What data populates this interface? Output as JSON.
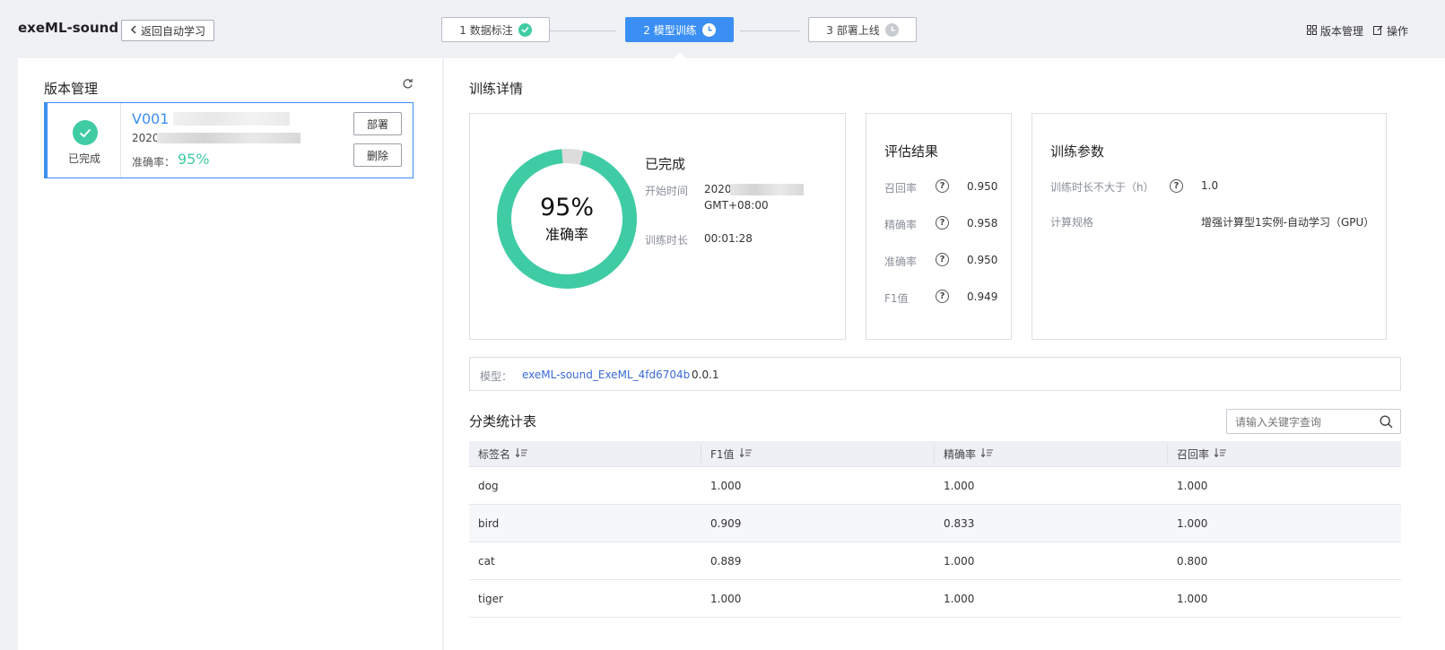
{
  "header": {
    "app_title": "exeML-sound",
    "back_label": "返回自动学习",
    "steps": [
      {
        "label": "1 数据标注",
        "state": "done"
      },
      {
        "label": "2 模型训练",
        "state": "active"
      },
      {
        "label": "3 部署上线",
        "state": "pending"
      }
    ],
    "version_mgmt_label": "版本管理",
    "ops_label": "操作"
  },
  "left": {
    "title": "版本管理",
    "version": {
      "name": "V001",
      "date_prefix": "2020",
      "status": "已完成",
      "accuracy_label": "准确率：",
      "accuracy_value": "95%",
      "deploy_label": "部署",
      "delete_label": "删除"
    }
  },
  "detail": {
    "title": "训练详情",
    "progress": {
      "percent_text": "95%",
      "percent": 0.95,
      "caption": "准确率",
      "status": "已完成",
      "start_label": "开始时间",
      "start_value_prefix": "2020",
      "start_tz": "GMT+08:00",
      "duration_label": "训练时长",
      "duration_value": "00:01:28"
    },
    "eval": {
      "title": "评估结果",
      "rows": [
        {
          "label": "召回率",
          "value": "0.950"
        },
        {
          "label": "精确率",
          "value": "0.958"
        },
        {
          "label": "准确率",
          "value": "0.950"
        },
        {
          "label": "F1值",
          "value": "0.949"
        }
      ]
    },
    "params": {
      "title": "训练参数",
      "rows": [
        {
          "label": "训练时长不大于（h）",
          "value": "1.0",
          "help": true
        },
        {
          "label": "计算规格",
          "value": "增强计算型1实例-自动学习（GPU）",
          "help": false
        }
      ]
    },
    "model": {
      "label": "模型：",
      "name": "exeML-sound_ExeML_4fd6704b",
      "version": "0.0.1"
    }
  },
  "table": {
    "title": "分类统计表",
    "search_placeholder": "请输入关键字查询",
    "columns": [
      "标签名",
      "F1值",
      "精确率",
      "召回率"
    ],
    "rows": [
      [
        "dog",
        "1.000",
        "1.000",
        "1.000"
      ],
      [
        "bird",
        "0.909",
        "0.833",
        "1.000"
      ],
      [
        "cat",
        "0.889",
        "1.000",
        "0.800"
      ],
      [
        "tiger",
        "1.000",
        "1.000",
        "1.000"
      ]
    ]
  },
  "colors": {
    "primary": "#3b8ff3",
    "success": "#3fcca4",
    "ring_bg": "#dcdcdc",
    "link": "#3b6ad8"
  }
}
